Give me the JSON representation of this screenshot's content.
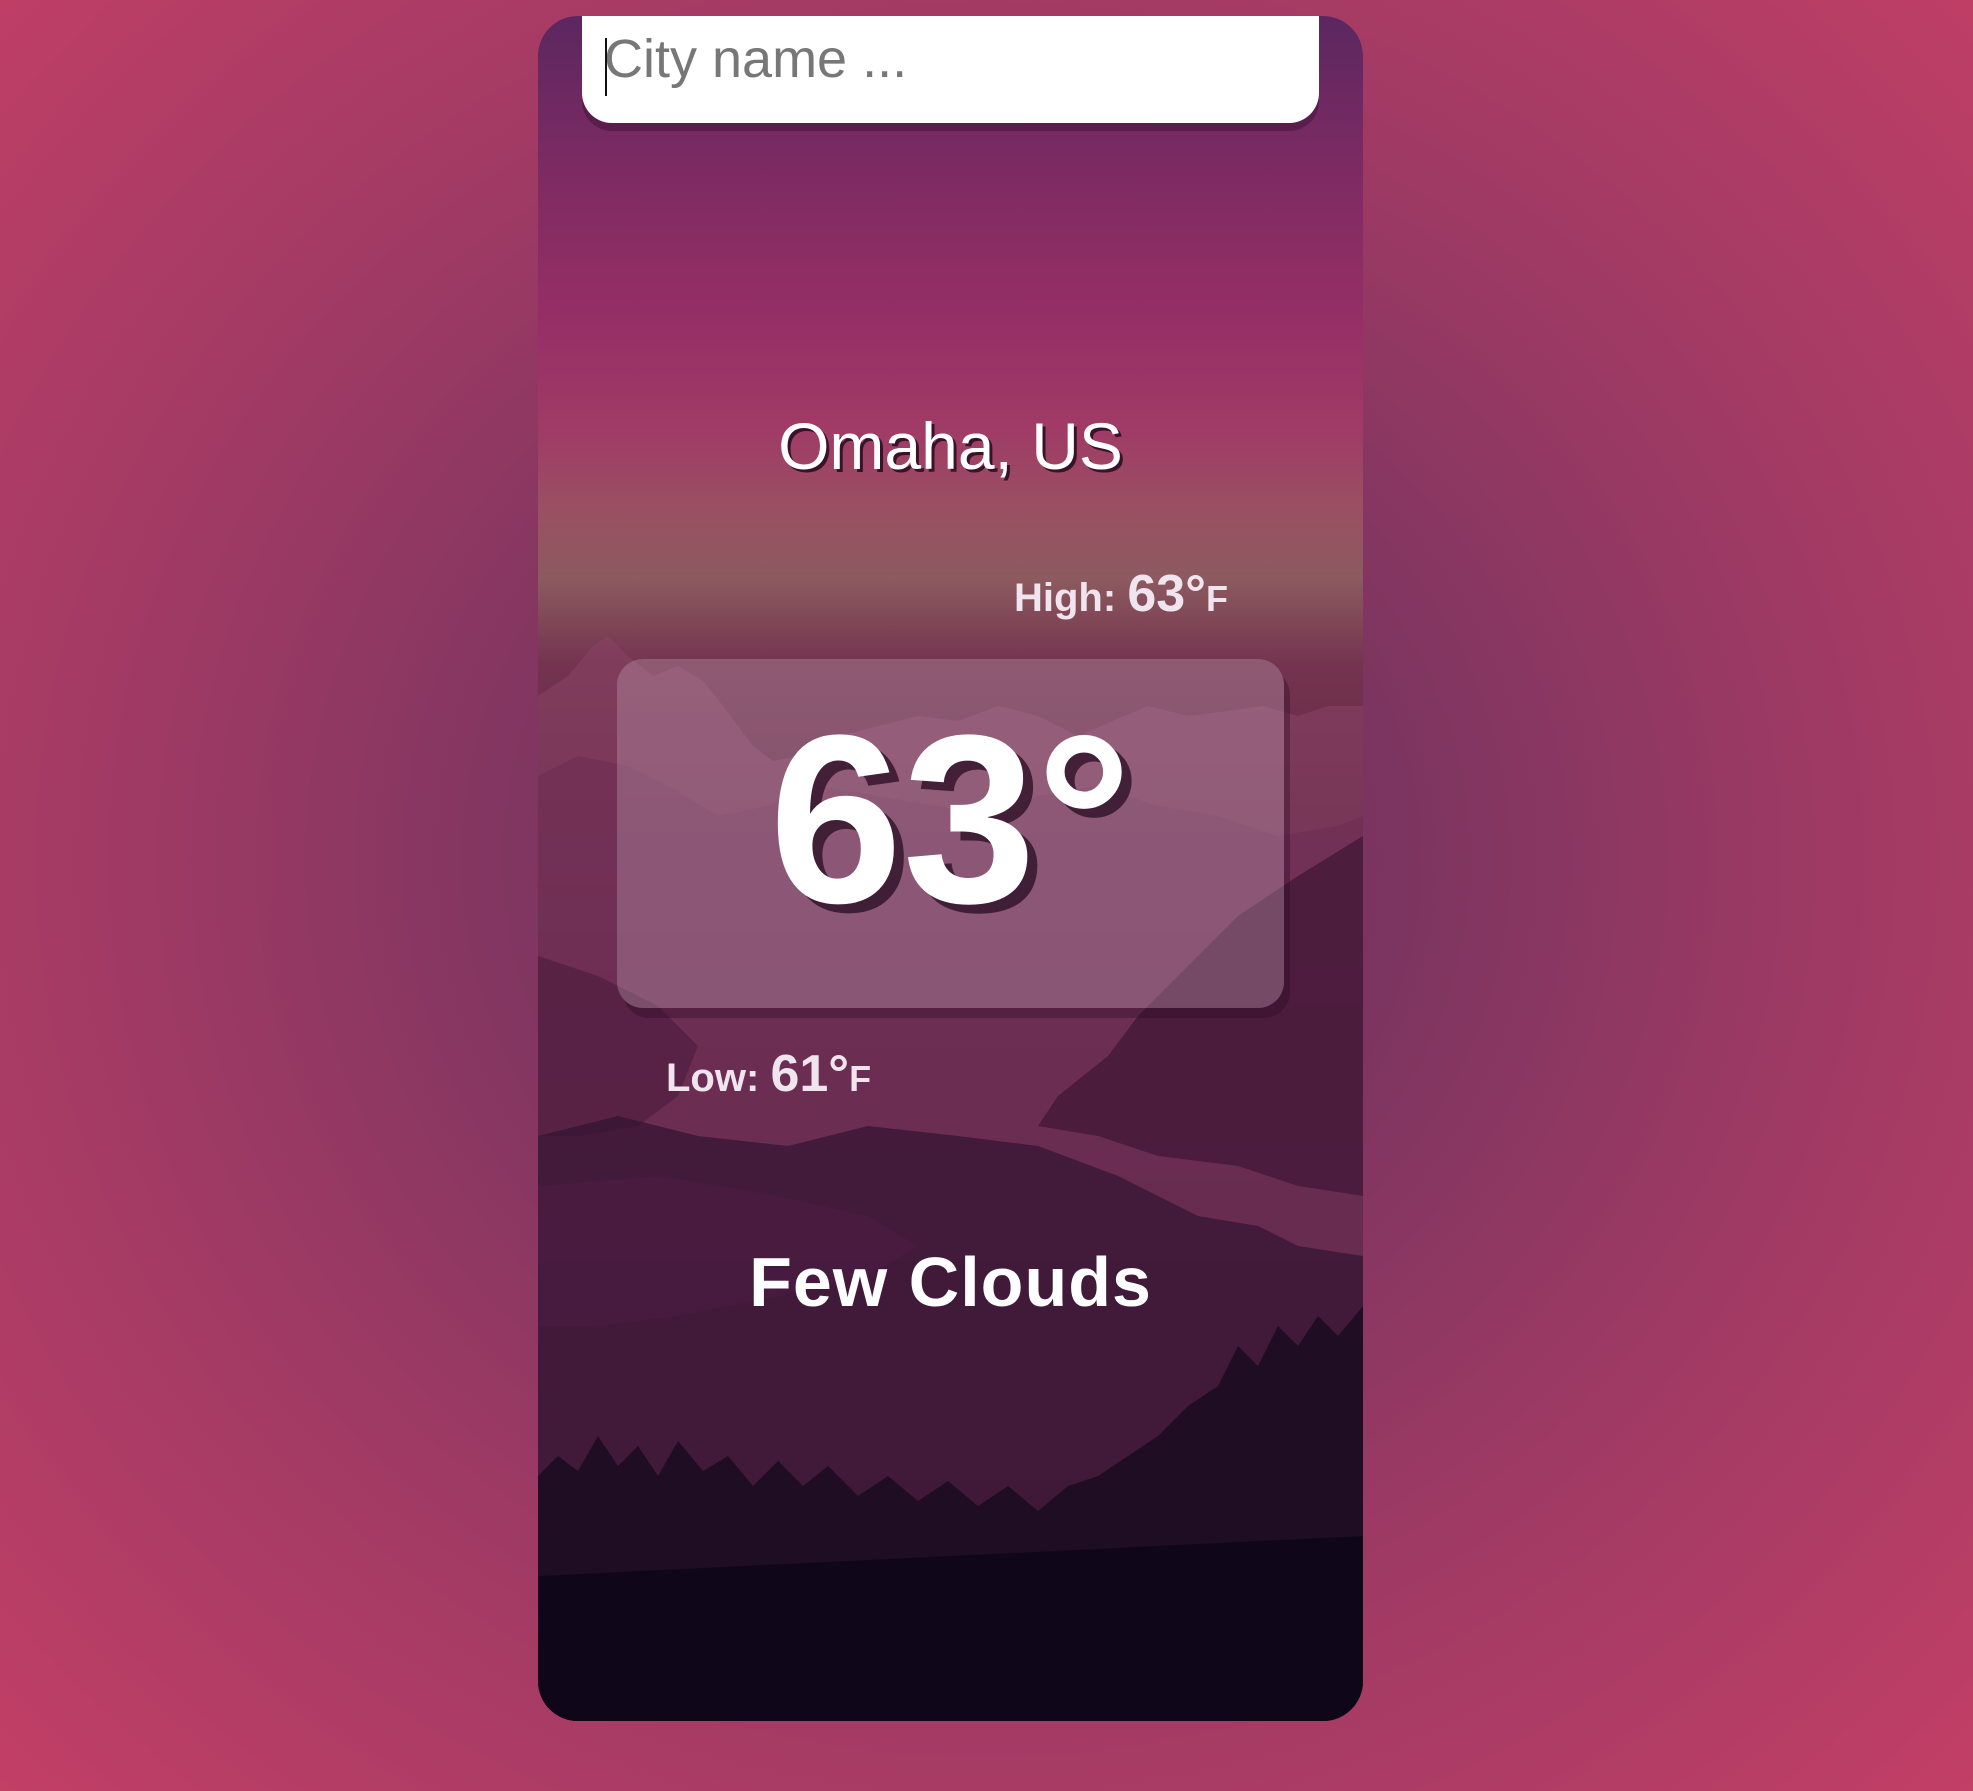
{
  "search": {
    "placeholder": "City name ...",
    "value": ""
  },
  "weather": {
    "location": "Omaha, US",
    "high_label": "High:",
    "high_value": "63°",
    "high_unit": "F",
    "temperature": "63°",
    "low_label": "Low:",
    "low_value": "61°",
    "low_unit": "F",
    "description": "Few Clouds"
  },
  "colors": {
    "page_background_edge": "#c23f66",
    "page_background_center": "#5e2e55",
    "card_top": "#5b2760",
    "card_bottom": "#0b0718",
    "text": "#ffffff"
  }
}
